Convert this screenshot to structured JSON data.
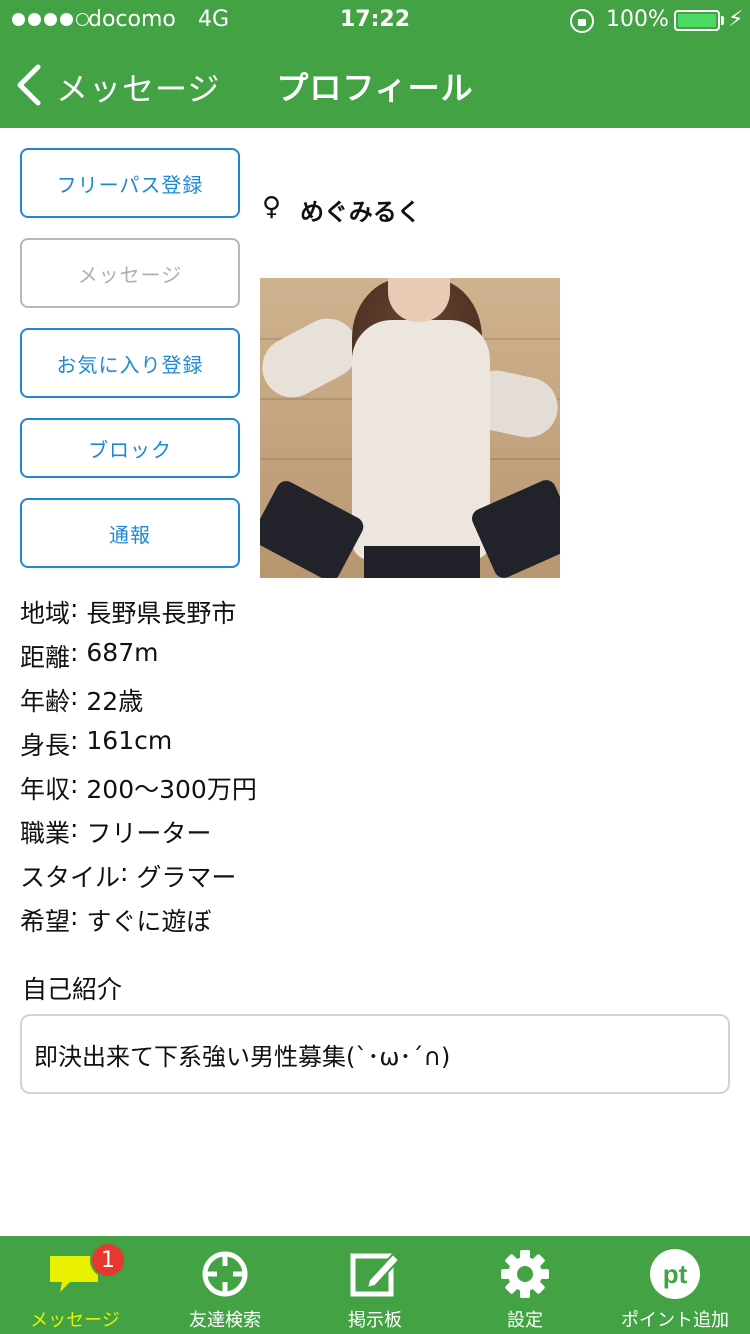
{
  "status_bar": {
    "carrier": "docomo",
    "network": "4G",
    "time": "17:22",
    "battery_percent": "100%",
    "signal_bars": 4
  },
  "nav": {
    "back_label": "メッセージ",
    "title": "プロフィール"
  },
  "actions": {
    "freepass": "フリーパス登録",
    "message": "メッセージ",
    "favorite": "お気に入り登録",
    "block": "ブロック",
    "report": "通報"
  },
  "profile": {
    "gender_symbol": "♀",
    "name": "めぐみるく",
    "photo_icon": "profile-photo",
    "fields": [
      {
        "label": "地域",
        "value": "長野県長野市"
      },
      {
        "label": "距離",
        "value": "687m"
      },
      {
        "label": "年齢",
        "value": "22歳"
      },
      {
        "label": "身長",
        "value": "161cm"
      },
      {
        "label": "年収",
        "value": "200〜300万円"
      },
      {
        "label": "職業",
        "value": "フリーター"
      },
      {
        "label": "スタイル",
        "value": "グラマー"
      },
      {
        "label": "希望",
        "value": "すぐに遊ぼ"
      }
    ],
    "intro_heading": "自己紹介",
    "intro_text": "即決出来て下系強い男性募集(`･ω･´∩)"
  },
  "tabbar": {
    "tabs": [
      {
        "label": "メッセージ",
        "icon": "chat-bubble-icon",
        "badge": "1",
        "active": true
      },
      {
        "label": "友達検索",
        "icon": "crosshair-icon"
      },
      {
        "label": "掲示板",
        "icon": "edit-icon"
      },
      {
        "label": "設定",
        "icon": "gear-icon"
      },
      {
        "label": "ポイント追加",
        "icon": "pt-icon",
        "icon_text": "pt"
      }
    ]
  },
  "colors": {
    "header_green": "#43a344",
    "button_blue": "#1e88d6",
    "active_tab": "#e8f000",
    "badge_red": "#e8372e"
  }
}
